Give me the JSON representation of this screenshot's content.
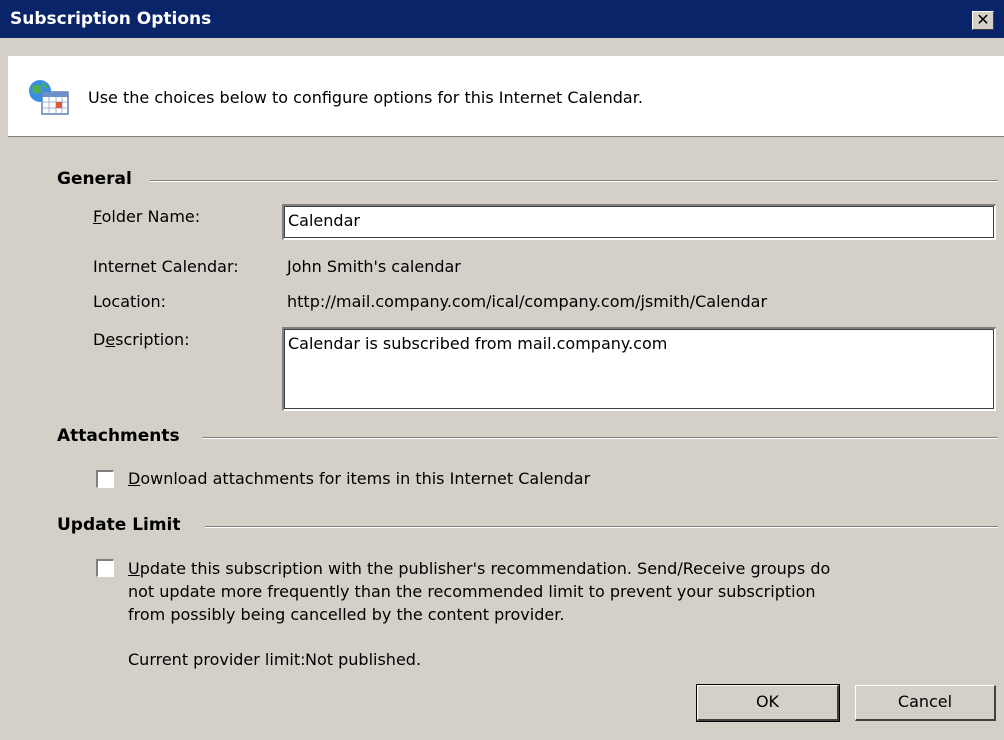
{
  "window": {
    "title": "Subscription Options",
    "close_glyph": "✕"
  },
  "header": {
    "icon": "internet-calendar-icon",
    "text": "Use the choices below to configure options for this Internet Calendar."
  },
  "general": {
    "heading": "General",
    "folder_name_label_key": "F",
    "folder_name_label_rest": "older Name:",
    "folder_name_value": "Calendar",
    "internet_calendar_label": "Internet Calendar:",
    "internet_calendar_value": "John Smith's calendar",
    "location_label": "Location:",
    "location_value": "http://mail.company.com/ical/company.com/jsmith/Calendar",
    "description_label_pre": "D",
    "description_label_key": "e",
    "description_label_rest": "scription:",
    "description_value": "Calendar is subscribed from mail.company.com"
  },
  "attachments": {
    "heading": "Attachments",
    "checkbox_key": "D",
    "checkbox_rest": "ownload attachments for items in this Internet Calendar",
    "checked": false
  },
  "update_limit": {
    "heading": "Update Limit",
    "checkbox_key": "U",
    "checkbox_line1_rest": "pdate this subscription with the publisher's recommendation. Send/Receive groups do",
    "checkbox_line2": "not update more frequently than the recommended limit to prevent your subscription",
    "checkbox_line3": "from possibly being cancelled by the content provider.",
    "checked": false,
    "provider_limit_label": "Current provider limit:",
    "provider_limit_value": "Not published."
  },
  "buttons": {
    "ok": "OK",
    "cancel": "Cancel"
  },
  "colors": {
    "titlebar": "#0a246a",
    "dialog_face": "#d4d0c8"
  }
}
